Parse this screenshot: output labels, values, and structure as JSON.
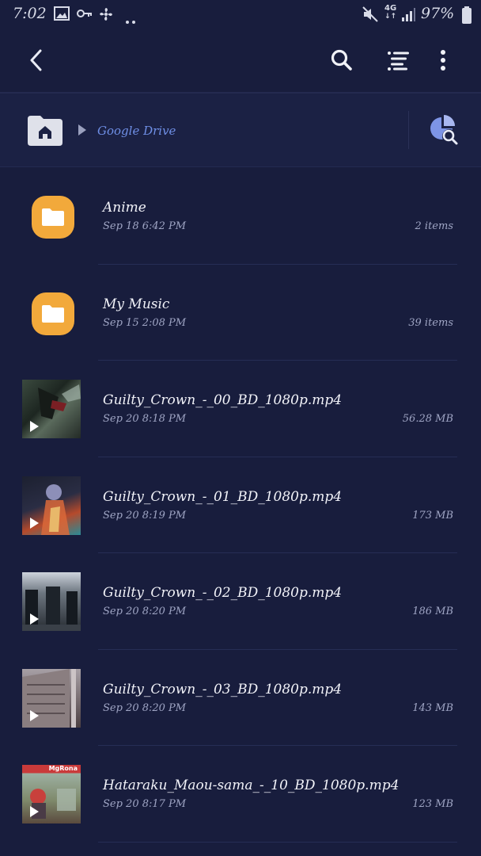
{
  "status_bar": {
    "time": "7:02",
    "battery_percent": "97%",
    "network": "4G",
    "icons": [
      "image-icon",
      "vpn-key-icon",
      "fan-icon",
      "more-dots-icon",
      "mute-icon",
      "network-4g-icon",
      "signal-icon",
      "battery-icon"
    ]
  },
  "toolbar": {
    "back": "back-arrow-icon",
    "search": "search-icon",
    "sort": "sort-icon",
    "more": "more-vert-icon"
  },
  "path": {
    "home": "home-icon",
    "crumb": "Google Drive",
    "storage_analysis": "storage-search-icon"
  },
  "colors": {
    "background": "#181d3d",
    "path_bar": "#1b2144",
    "folder": "#f2a93b",
    "crumb_text": "#6f8fe6"
  },
  "files": [
    {
      "type": "folder",
      "name": "Anime",
      "date": "Sep 18 6:42 PM",
      "meta": "2 items"
    },
    {
      "type": "folder",
      "name": "My Music",
      "date": "Sep 15 2:08 PM",
      "meta": "39 items"
    },
    {
      "type": "video",
      "name": "Guilty_Crown_-_00_BD_1080p.mp4",
      "date": "Sep 20 8:18 PM",
      "meta": "56.28 MB"
    },
    {
      "type": "video",
      "name": "Guilty_Crown_-_01_BD_1080p.mp4",
      "date": "Sep 20 8:19 PM",
      "meta": "173 MB"
    },
    {
      "type": "video",
      "name": "Guilty_Crown_-_02_BD_1080p.mp4",
      "date": "Sep 20 8:20 PM",
      "meta": "186 MB"
    },
    {
      "type": "video",
      "name": "Guilty_Crown_-_03_BD_1080p.mp4",
      "date": "Sep 20 8:20 PM",
      "meta": "143 MB"
    },
    {
      "type": "video",
      "name": "Hataraku_Maou-sama_-_10_BD_1080p.mp4",
      "date": "Sep 20 8:17 PM",
      "meta": "123 MB",
      "thumb_text": "MgRona"
    }
  ]
}
